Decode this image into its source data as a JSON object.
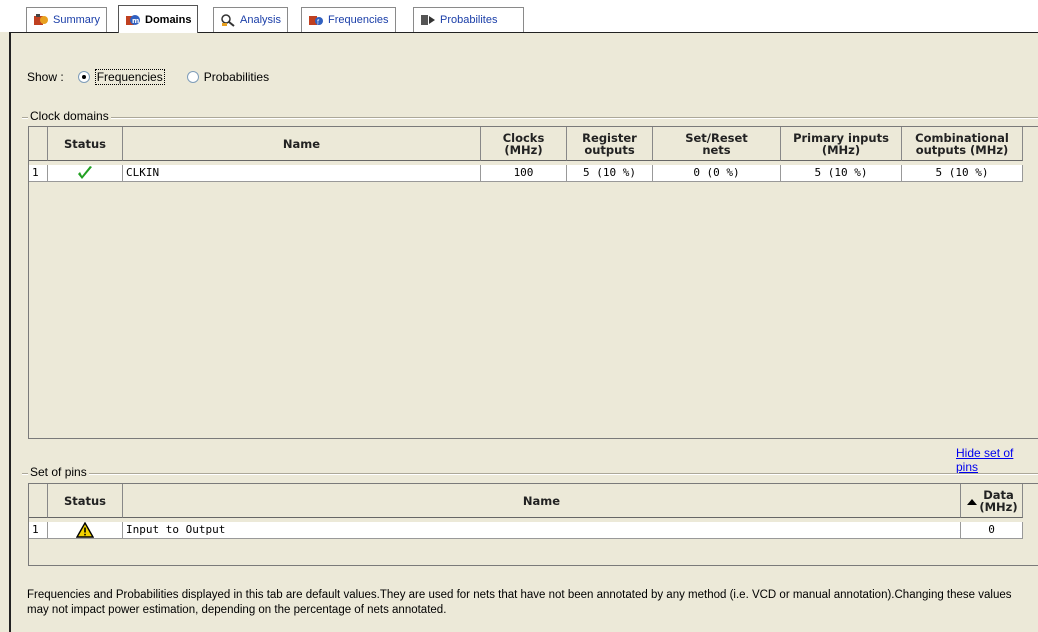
{
  "tabs": [
    {
      "label": "Summary",
      "icon": "summary-icon",
      "active": false
    },
    {
      "label": "Domains",
      "icon": "domains-icon",
      "active": true
    },
    {
      "label": "Analysis",
      "icon": "analysis-icon",
      "active": false
    },
    {
      "label": "Frequencies",
      "icon": "frequencies-icon",
      "active": false
    },
    {
      "label": "Probabilites",
      "icon": "probabilities-icon",
      "active": false
    }
  ],
  "show": {
    "label": "Show :",
    "options": [
      {
        "label": "Frequencies",
        "selected": true
      },
      {
        "label": "Probabilities",
        "selected": false
      }
    ]
  },
  "clock_domains": {
    "title": "Clock domains",
    "columns": [
      "",
      "Status",
      "Name",
      "Clocks\n(MHz)",
      "Register\noutputs",
      "Set/Reset\nnets",
      "Primary inputs\n(MHz)",
      "Combinational\noutputs (MHz)"
    ],
    "rows": [
      {
        "index": "1",
        "status": "ok",
        "name": "CLKIN",
        "clocks": "100",
        "register_outputs": "5 (10 %)",
        "set_reset_nets": "0 (0 %)",
        "primary_inputs": "5 (10 %)",
        "combinational_outputs": "5 (10 %)"
      }
    ]
  },
  "hide_link": "Hide set of pins",
  "set_of_pins": {
    "title": "Set of pins",
    "columns": [
      "",
      "Status",
      "Name",
      "Data\n(MHz)"
    ],
    "rows": [
      {
        "index": "1",
        "status": "warning",
        "name": "Input to Output",
        "data": "0"
      }
    ]
  },
  "footer_text": "Frequencies and Probabilities displayed in this tab are default values.They are used for nets that have not been annotated by any method (i.e. VCD or manual annotation).Changing these values may not impact power estimation, depending on the percentage of nets annotated.",
  "colors": {
    "ok": "#22a022",
    "warning": "#f2d200",
    "link": "#0000ee"
  }
}
